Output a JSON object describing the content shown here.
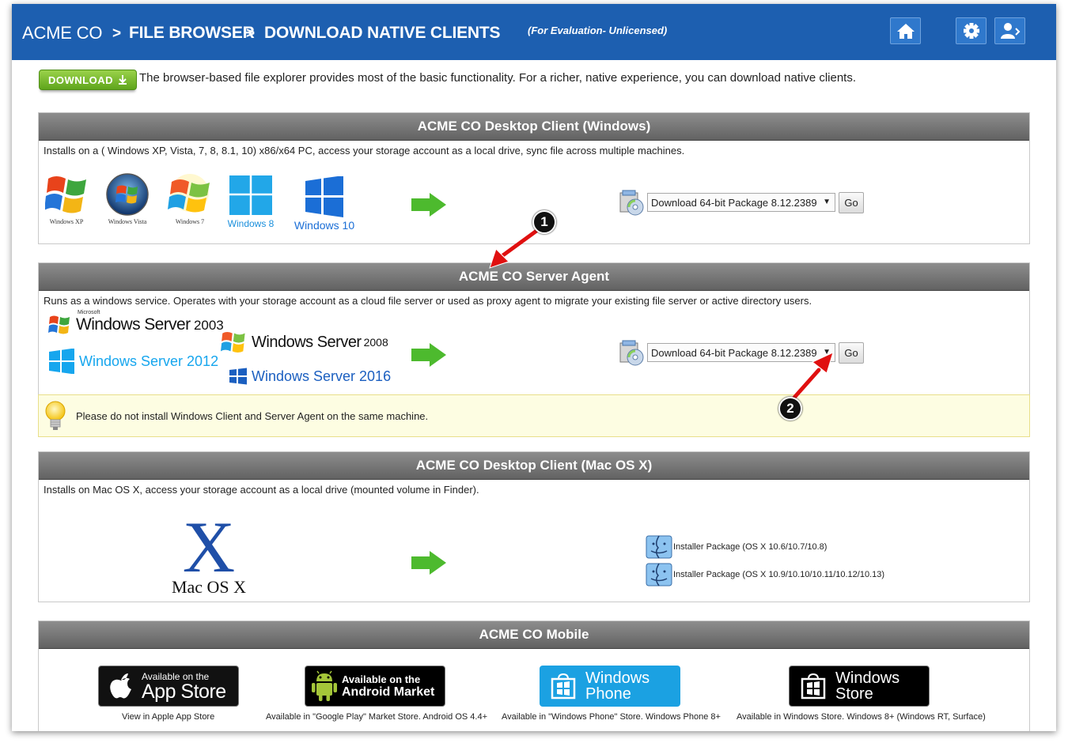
{
  "header": {
    "brand": "ACME CO",
    "sep": ">",
    "crumb_2": "FILE BROWSER",
    "crumb_3": "DOWNLOAD NATIVE CLIENTS",
    "evaluation": "(For Evaluation- Unlicensed)",
    "icons": [
      "home-icon",
      "gear-icon",
      "user-profile-icon"
    ]
  },
  "intro": {
    "download_label": "DOWNLOAD",
    "text": "The browser-based file explorer provides most of the basic functionality. For a richer, native experience, you can download native clients."
  },
  "windows_client": {
    "title": "ACME CO Desktop Client (Windows)",
    "desc": "Installs on a ( Windows XP, Vista, 7, 8, 8.1, 10) x86/x64 PC, access your storage account as a local drive, sync file across multiple machines.",
    "os": [
      "Windows XP",
      "Windows Vista",
      "Windows 7",
      "Windows 8",
      "Windows 10"
    ],
    "package": "Download 64-bit Package 8.12.2389",
    "go": "Go"
  },
  "server_agent": {
    "title": "ACME CO Server Agent",
    "desc": "Runs as a windows service. Operates with your storage account as a cloud file server or used as proxy agent to migrate your existing file server or active directory users.",
    "microsoft": "Microsoft",
    "srv2003": "Windows Server",
    "srv2003_ver": "2003",
    "srv2008": "Windows Server",
    "srv2008_ver": "2008",
    "srv2012": "Windows Server 2012",
    "srv2016": "Windows Server 2016",
    "package": "Download 64-bit Package 8.12.2389",
    "go": "Go"
  },
  "tip": "Please do not install Windows Client and Server Agent on the same machine.",
  "mac_client": {
    "title": "ACME CO Desktop Client (Mac OS X)",
    "desc": "Installs on Mac OS X, access your storage account as a local drive (mounted volume in Finder).",
    "logo_x": "X",
    "logo_text": "Mac OS X",
    "pkg1": "Installer Package (OS X 10.6/10.7/10.8)",
    "pkg2": "Installer Package (OS X 10.9/10.10/10.11/10.12/10.13)"
  },
  "mobile": {
    "title": "ACME CO Mobile",
    "appstore_small": "Available on the",
    "appstore_big": "App Store",
    "appstore_caption": "View in Apple App Store",
    "android_small": "Available on the",
    "android_big": "Android Market",
    "android_caption": "Available in \"Google Play\" Market Store. Android OS 4.4+",
    "wphone_l1": "Windows",
    "wphone_l2": "Phone",
    "wphone_caption": "Available in \"Windows Phone\" Store. Windows Phone 8+",
    "wstore_l1": "Windows",
    "wstore_l2": "Store",
    "wstore_caption": "Available in Windows Store. Windows 8+ (Windows RT, Surface)"
  },
  "annotations": [
    "1",
    "2"
  ],
  "colors": {
    "header": "#1d5fb0",
    "panel_head": "#6f6f6f",
    "download_green": "#7cc234",
    "annotation_red": "#e01010"
  }
}
